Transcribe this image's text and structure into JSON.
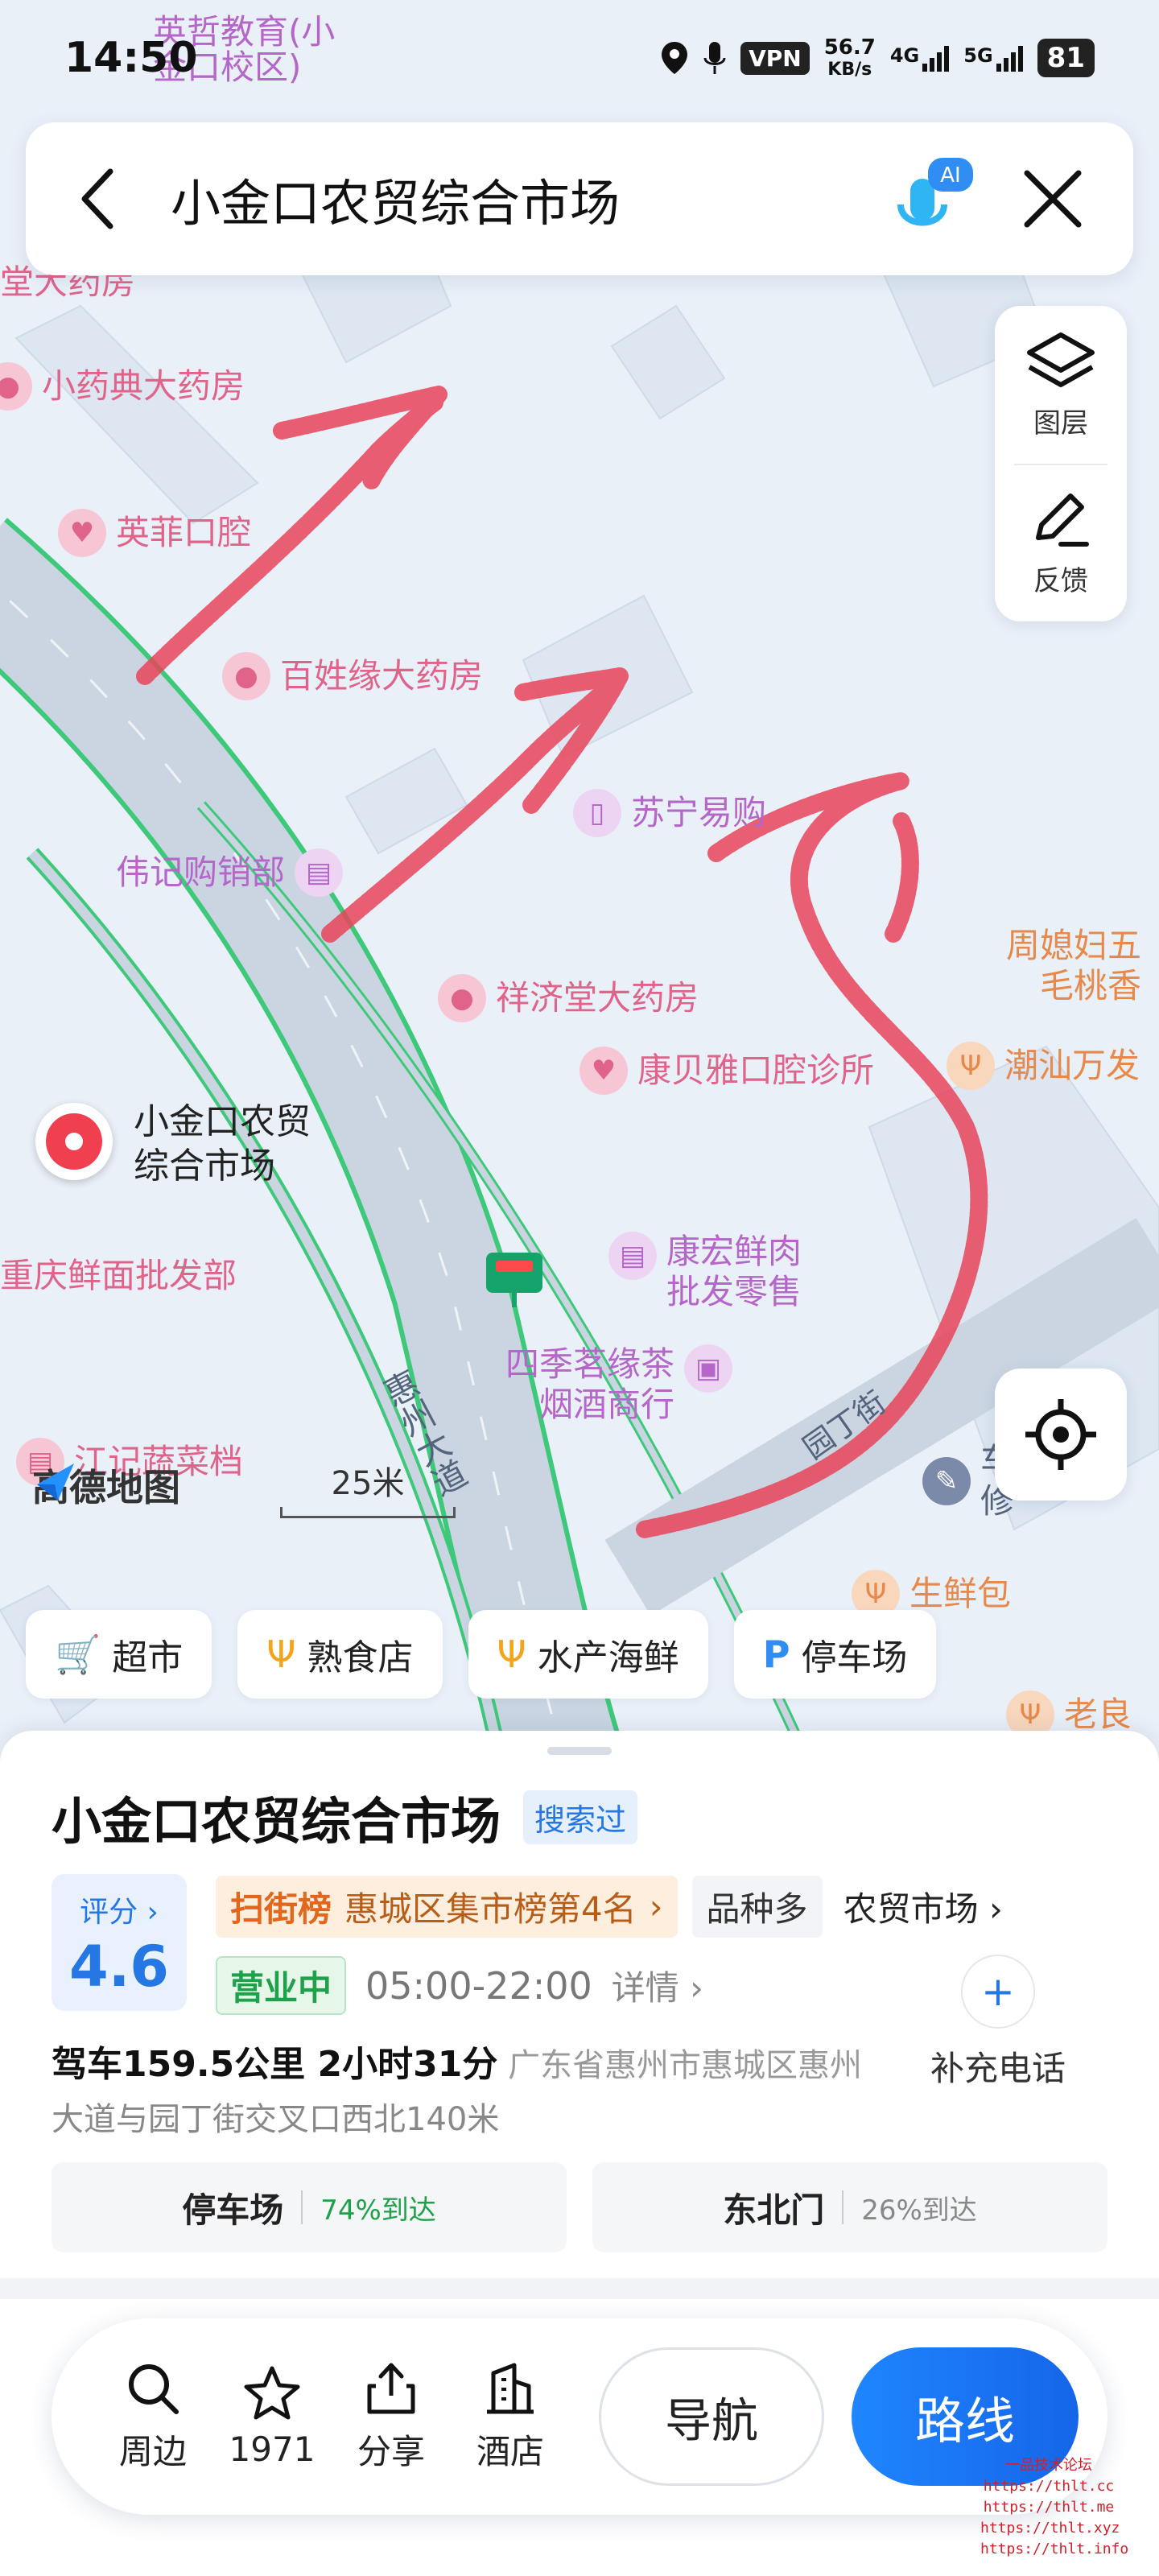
{
  "status_bar": {
    "time": "14:50",
    "vpn": "VPN",
    "speed_value": "56.7",
    "speed_unit": "KB/s",
    "network_1": "4G",
    "network_2": "5G",
    "battery": "81"
  },
  "search": {
    "query": "小金口农贸综合市场",
    "ai_label": "AI"
  },
  "map_controls": {
    "layers_label": "图层",
    "feedback_label": "反馈"
  },
  "map": {
    "logo_text": "高德地图",
    "scale_label": "25米",
    "road_huizhou": "惠州大道",
    "road_yuanding": "园丁街",
    "pin_label_line1": "小金口农贸",
    "pin_label_line2": "综合市场",
    "pois": {
      "yingzhe_1": "英哲教育(小",
      "yingzhe_2": "金口校区)",
      "tang_pharmacy": "堂大药房",
      "xiaoyaodian": "小药典大药房",
      "yingfei": "英菲口腔",
      "baixingyuan": "百姓缘大药房",
      "suning": "苏宁易购",
      "weiji": "伟记购销部",
      "xiangjitang": "祥济堂大药房",
      "kangbeiya": "康贝雅口腔诊所",
      "zhouxifu_1": "周媳妇五",
      "zhouxifu_2": "毛桃香",
      "chaoshan": "潮汕万发",
      "chongqing": "重庆鲜面批发部",
      "kanghong_1": "康宏鲜肉",
      "kanghong_2": "批发零售",
      "siji_1": "四季茗缘茶",
      "siji_2": "烟酒商行",
      "jiangji": "江记蔬菜档",
      "shengxianbao": "生鲜包",
      "laoliang": "老良",
      "right_edge_1": "车",
      "right_edge_2": "修"
    }
  },
  "chips": [
    {
      "icon": "cart-icon",
      "label": "超市"
    },
    {
      "icon": "utensils-icon",
      "label": "熟食店"
    },
    {
      "icon": "utensils-icon",
      "label": "水产海鲜"
    },
    {
      "icon": "parking-icon",
      "label": "停车场"
    }
  ],
  "place": {
    "title": "小金口农贸综合市场",
    "searched_tag": "搜索过",
    "rating_label": "评分",
    "rating_value": "4.6",
    "rank_badge": "扫街榜",
    "rank_text": "惠城区集市榜第4名",
    "tag_variety": "品种多",
    "category": "农贸市场",
    "open_status": "营业中",
    "hours": "05:00-22:00",
    "details_label": "详情",
    "add_phone_label": "补充电话",
    "drive_info": "驾车159.5公里 2小时31分",
    "address_line1": "广东省惠州市惠城区惠州",
    "address_line2": "大道与园丁街交叉口西北140米",
    "entrances": [
      {
        "name": "停车场",
        "pct": "74%到达"
      },
      {
        "name": "东北门",
        "pct": "26%到达"
      }
    ]
  },
  "bottom_nav": {
    "nearby": "周边",
    "favorites": "1971",
    "share": "分享",
    "hotel": "酒店",
    "navigate": "导航",
    "route": "路线"
  },
  "watermark": {
    "line1": "一品技术论坛",
    "line2": "https://thlt.cc",
    "line3": "https://thlt.me",
    "line4": "https://thlt.xyz",
    "line5": "https://thlt.info"
  },
  "colors": {
    "accent_blue": "#2577e3",
    "open_green": "#1ea14a",
    "rank_orange": "#e2671c",
    "pin_red": "#f0404f",
    "scribble_red": "#e8445a",
    "road_green": "#3ec97a"
  }
}
